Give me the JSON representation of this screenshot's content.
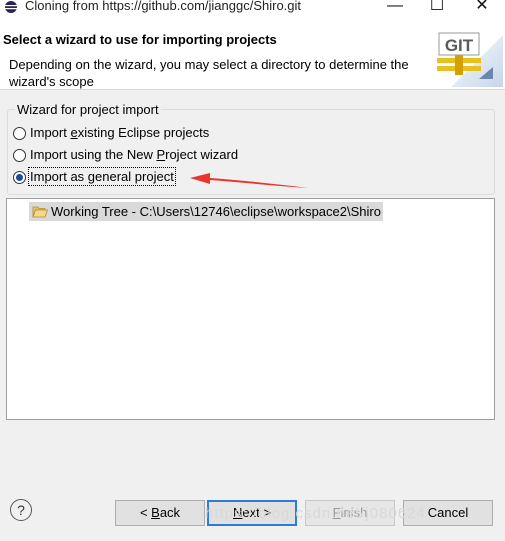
{
  "window": {
    "title": "Cloning from https://github.com/jianggc/Shiro.git",
    "minimize_glyph": "—",
    "maximize_glyph": "☐",
    "close_glyph": "✕"
  },
  "header": {
    "title": "Select a wizard to use for importing projects",
    "description": "Depending on the wizard, you may select a directory to determine the wizard's scope",
    "logo_text": "GIT"
  },
  "wizard_group": {
    "label": "Wizard for project import",
    "options": [
      {
        "pre": "Import ",
        "mnemonic": "e",
        "post": "xisting Eclipse projects",
        "checked": false
      },
      {
        "pre": "Import using the New ",
        "mnemonic": "P",
        "post": "roject wizard",
        "checked": false
      },
      {
        "pre": "Import as ",
        "mnemonic": "g",
        "post": "eneral project",
        "checked": true
      }
    ]
  },
  "tree": {
    "items": [
      {
        "label": "Working Tree - C:\\Users\\12746\\eclipse\\workspace2\\Shiro",
        "icon": "folder-open-icon"
      }
    ]
  },
  "buttons": {
    "help": "?",
    "back_pre": "< ",
    "back_mnemonic": "B",
    "back_post": "ack",
    "next_mnemonic": "N",
    "next_post": "ext >",
    "finish_mnemonic": "F",
    "finish_post": "inish",
    "cancel": "Cancel"
  },
  "watermark": "https://blog.csdn.net/j080624",
  "colors": {
    "arrow": "#e8352d",
    "radio_selected": "#1a4a9a",
    "default_button_border": "#2f7bd6"
  }
}
